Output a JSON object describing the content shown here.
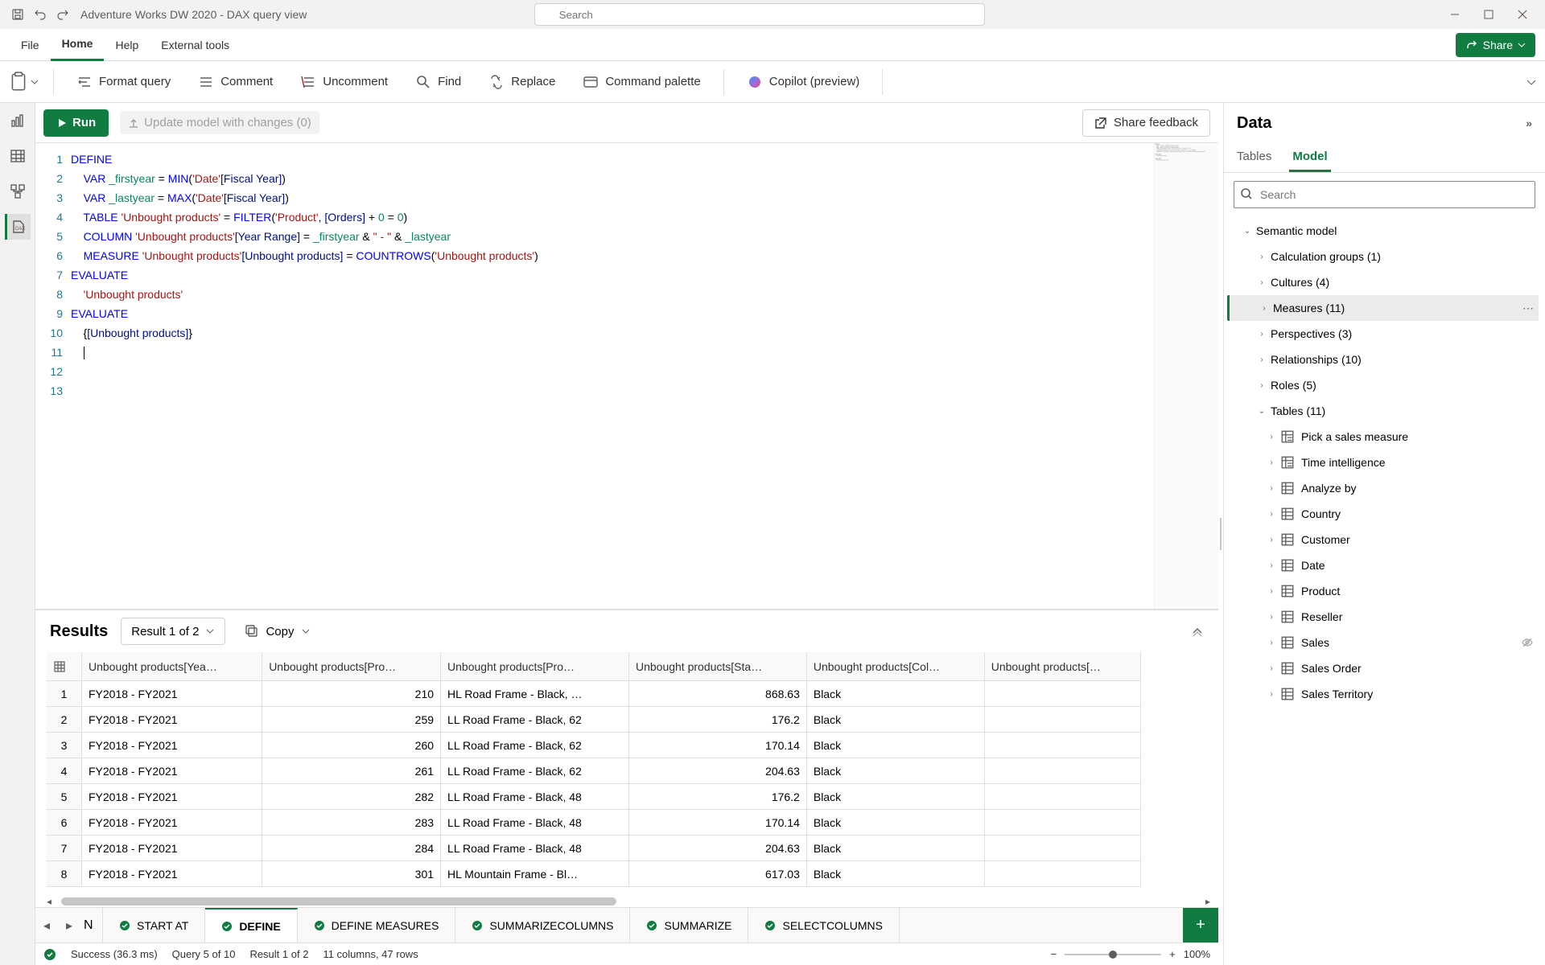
{
  "titlebar": {
    "title": "Adventure Works DW 2020 - DAX query view",
    "search_placeholder": "Search"
  },
  "menu": {
    "items": [
      "File",
      "Home",
      "Help",
      "External tools"
    ],
    "active": "Home",
    "share_label": "Share"
  },
  "ribbon": {
    "format_query": "Format query",
    "comment": "Comment",
    "uncomment": "Uncomment",
    "find": "Find",
    "replace": "Replace",
    "command_palette": "Command palette",
    "copilot": "Copilot (preview)"
  },
  "querybar": {
    "run_label": "Run",
    "update_label": "Update model with changes (0)",
    "share_feedback": "Share feedback"
  },
  "editor": {
    "lines": [
      {
        "n": 1,
        "segs": [
          {
            "t": "DEFINE",
            "c": "kw"
          }
        ]
      },
      {
        "n": 2,
        "segs": [
          {
            "t": "    ",
            "c": ""
          },
          {
            "t": "VAR",
            "c": "kw"
          },
          {
            "t": " _firstyear ",
            "c": "var"
          },
          {
            "t": "= ",
            "c": "op"
          },
          {
            "t": "MIN",
            "c": "fn"
          },
          {
            "t": "(",
            "c": "op"
          },
          {
            "t": "'Date'",
            "c": "str"
          },
          {
            "t": "[Fiscal Year]",
            "c": "col"
          },
          {
            "t": ")",
            "c": "op"
          }
        ]
      },
      {
        "n": 3,
        "segs": [
          {
            "t": "    ",
            "c": ""
          },
          {
            "t": "VAR",
            "c": "kw"
          },
          {
            "t": " _lastyear ",
            "c": "var"
          },
          {
            "t": "= ",
            "c": "op"
          },
          {
            "t": "MAX",
            "c": "fn"
          },
          {
            "t": "(",
            "c": "op"
          },
          {
            "t": "'Date'",
            "c": "str"
          },
          {
            "t": "[Fiscal Year]",
            "c": "col"
          },
          {
            "t": ")",
            "c": "op"
          }
        ]
      },
      {
        "n": 4,
        "segs": [
          {
            "t": "    ",
            "c": ""
          },
          {
            "t": "TABLE",
            "c": "kw"
          },
          {
            "t": " ",
            "c": ""
          },
          {
            "t": "'Unbought products'",
            "c": "str"
          },
          {
            "t": " = ",
            "c": "op"
          },
          {
            "t": "FILTER",
            "c": "fn"
          },
          {
            "t": "(",
            "c": "op"
          },
          {
            "t": "'Product'",
            "c": "str"
          },
          {
            "t": ", ",
            "c": "op"
          },
          {
            "t": "[Orders]",
            "c": "col"
          },
          {
            "t": " + ",
            "c": "op"
          },
          {
            "t": "0",
            "c": "num"
          },
          {
            "t": " = ",
            "c": "op"
          },
          {
            "t": "0",
            "c": "num"
          },
          {
            "t": ")",
            "c": "op"
          }
        ]
      },
      {
        "n": 5,
        "segs": [
          {
            "t": "    ",
            "c": ""
          },
          {
            "t": "COLUMN",
            "c": "kw"
          },
          {
            "t": " ",
            "c": ""
          },
          {
            "t": "'Unbought products'",
            "c": "str"
          },
          {
            "t": "[Year Range]",
            "c": "col"
          },
          {
            "t": " = ",
            "c": "op"
          },
          {
            "t": "_firstyear",
            "c": "var"
          },
          {
            "t": " & ",
            "c": "op"
          },
          {
            "t": "\" - \"",
            "c": "str"
          },
          {
            "t": " & ",
            "c": "op"
          },
          {
            "t": "_lastyear",
            "c": "var"
          }
        ]
      },
      {
        "n": 6,
        "segs": [
          {
            "t": "    ",
            "c": ""
          },
          {
            "t": "MEASURE",
            "c": "kw"
          },
          {
            "t": " ",
            "c": ""
          },
          {
            "t": "'Unbought products'",
            "c": "str"
          },
          {
            "t": "[Unbought products]",
            "c": "col"
          },
          {
            "t": " = ",
            "c": "op"
          },
          {
            "t": "COUNTROWS",
            "c": "fn"
          },
          {
            "t": "(",
            "c": "op"
          },
          {
            "t": "'Unbought products'",
            "c": "str"
          },
          {
            "t": ")",
            "c": "op"
          }
        ]
      },
      {
        "n": 7,
        "segs": [
          {
            "t": "",
            "c": ""
          }
        ]
      },
      {
        "n": 8,
        "segs": [
          {
            "t": "EVALUATE",
            "c": "kw"
          }
        ]
      },
      {
        "n": 9,
        "segs": [
          {
            "t": "    ",
            "c": ""
          },
          {
            "t": "'Unbought products'",
            "c": "str"
          }
        ]
      },
      {
        "n": 10,
        "segs": [
          {
            "t": "",
            "c": ""
          }
        ]
      },
      {
        "n": 11,
        "segs": [
          {
            "t": "EVALUATE",
            "c": "kw"
          }
        ]
      },
      {
        "n": 12,
        "segs": [
          {
            "t": "    {",
            "c": "op"
          },
          {
            "t": "[Unbought products]",
            "c": "col"
          },
          {
            "t": "}",
            "c": "op"
          }
        ]
      },
      {
        "n": 13,
        "segs": [
          {
            "t": "    ",
            "c": ""
          }
        ],
        "cursor": true
      }
    ]
  },
  "results": {
    "title": "Results",
    "selector": "Result 1 of 2",
    "copy_label": "Copy",
    "columns": [
      "",
      "Unbought products[Yea…",
      "Unbought products[Pro…",
      "Unbought products[Pro…",
      "Unbought products[Sta…",
      "Unbought products[Col…",
      "Unbought products[…"
    ],
    "rows": [
      {
        "n": 1,
        "year": "FY2018 - FY2021",
        "pid": "210",
        "name": "HL Road Frame - Black, …",
        "cost": "868.63",
        "color": "Black",
        "extra": ""
      },
      {
        "n": 2,
        "year": "FY2018 - FY2021",
        "pid": "259",
        "name": "LL Road Frame - Black, 62",
        "cost": "176.2",
        "color": "Black",
        "extra": ""
      },
      {
        "n": 3,
        "year": "FY2018 - FY2021",
        "pid": "260",
        "name": "LL Road Frame - Black, 62",
        "cost": "170.14",
        "color": "Black",
        "extra": ""
      },
      {
        "n": 4,
        "year": "FY2018 - FY2021",
        "pid": "261",
        "name": "LL Road Frame - Black, 62",
        "cost": "204.63",
        "color": "Black",
        "extra": ""
      },
      {
        "n": 5,
        "year": "FY2018 - FY2021",
        "pid": "282",
        "name": "LL Road Frame - Black, 48",
        "cost": "176.2",
        "color": "Black",
        "extra": ""
      },
      {
        "n": 6,
        "year": "FY2018 - FY2021",
        "pid": "283",
        "name": "LL Road Frame - Black, 48",
        "cost": "170.14",
        "color": "Black",
        "extra": ""
      },
      {
        "n": 7,
        "year": "FY2018 - FY2021",
        "pid": "284",
        "name": "LL Road Frame - Black, 48",
        "cost": "204.63",
        "color": "Black",
        "extra": ""
      },
      {
        "n": 8,
        "year": "FY2018 - FY2021",
        "pid": "301",
        "name": "HL Mountain Frame - Bl…",
        "cost": "617.03",
        "color": "Black",
        "extra": ""
      }
    ]
  },
  "tabs": {
    "partial": "N",
    "items": [
      {
        "label": "START AT",
        "active": false
      },
      {
        "label": "DEFINE",
        "active": true
      },
      {
        "label": "DEFINE MEASURES",
        "active": false
      },
      {
        "label": "SUMMARIZECOLUMNS",
        "active": false
      },
      {
        "label": "SUMMARIZE",
        "active": false
      },
      {
        "label": "SELECTCOLUMNS",
        "active": false
      }
    ]
  },
  "statusbar": {
    "success": "Success (36.3 ms)",
    "query_pos": "Query 5 of 10",
    "result_pos": "Result 1 of 2",
    "dims": "11 columns, 47 rows",
    "zoom": "100%"
  },
  "datapane": {
    "title": "Data",
    "tabs": [
      "Tables",
      "Model"
    ],
    "active_tab": "Model",
    "search_placeholder": "Search",
    "tree": [
      {
        "level": 1,
        "label": "Semantic model",
        "expand": "down"
      },
      {
        "level": 2,
        "label": "Calculation groups (1)",
        "expand": "right"
      },
      {
        "level": 2,
        "label": "Cultures (4)",
        "expand": "right"
      },
      {
        "level": 2,
        "label": "Measures (11)",
        "expand": "right",
        "selected": true
      },
      {
        "level": 2,
        "label": "Perspectives (3)",
        "expand": "right"
      },
      {
        "level": 2,
        "label": "Relationships (10)",
        "expand": "right"
      },
      {
        "level": 2,
        "label": "Roles (5)",
        "expand": "right"
      },
      {
        "level": 2,
        "label": "Tables (11)",
        "expand": "down"
      },
      {
        "level": 3,
        "label": "Pick a sales measure",
        "expand": "right",
        "icon": "calc-table"
      },
      {
        "level": 3,
        "label": "Time intelligence",
        "expand": "right",
        "icon": "calc-table"
      },
      {
        "level": 3,
        "label": "Analyze by",
        "expand": "right",
        "icon": "table"
      },
      {
        "level": 3,
        "label": "Country",
        "expand": "right",
        "icon": "table"
      },
      {
        "level": 3,
        "label": "Customer",
        "expand": "right",
        "icon": "table"
      },
      {
        "level": 3,
        "label": "Date",
        "expand": "right",
        "icon": "table"
      },
      {
        "level": 3,
        "label": "Product",
        "expand": "right",
        "icon": "table"
      },
      {
        "level": 3,
        "label": "Reseller",
        "expand": "right",
        "icon": "table"
      },
      {
        "level": 3,
        "label": "Sales",
        "expand": "right",
        "icon": "table",
        "hidden": true
      },
      {
        "level": 3,
        "label": "Sales Order",
        "expand": "right",
        "icon": "table"
      },
      {
        "level": 3,
        "label": "Sales Territory",
        "expand": "right",
        "icon": "table"
      }
    ]
  }
}
